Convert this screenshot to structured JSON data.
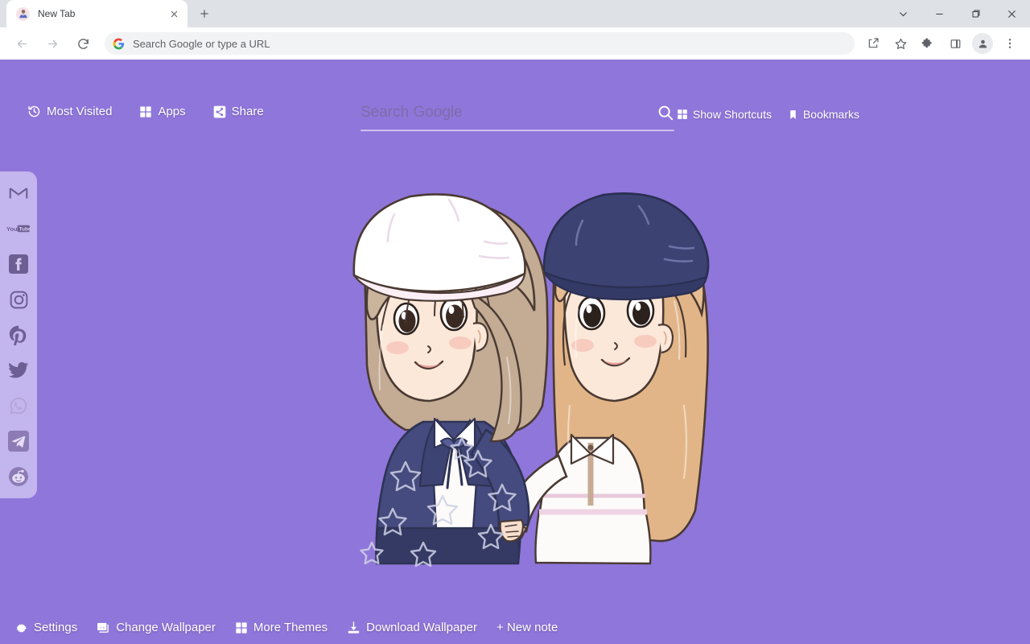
{
  "browser": {
    "tab": {
      "title": "New Tab",
      "favicon_icon": "avatar-person-icon",
      "close_icon": "close-icon"
    },
    "new_tab_button_icon": "plus-icon",
    "window_controls": [
      {
        "name": "tab-search",
        "icon": "chevron-down-icon"
      },
      {
        "name": "minimize",
        "icon": "minimize-icon"
      },
      {
        "name": "maximize",
        "icon": "restore-icon"
      },
      {
        "name": "close",
        "icon": "close-icon"
      }
    ],
    "nav": {
      "back_icon": "arrow-left-icon",
      "forward_icon": "arrow-right-icon",
      "reload_icon": "reload-icon"
    },
    "omnibox": {
      "placeholder": "Search Google or type a URL",
      "value": "",
      "leading_icon": "google-g-icon"
    },
    "toolbar_icons": [
      {
        "name": "share-icon"
      },
      {
        "name": "bookmark-star-icon"
      },
      {
        "name": "extensions-puzzle-icon"
      },
      {
        "name": "side-panel-icon"
      },
      {
        "name": "profile-avatar-icon"
      },
      {
        "name": "more-menu-icon"
      }
    ]
  },
  "newtab": {
    "background_color": "#8f76da",
    "quicknav": [
      {
        "label": "Most Visited",
        "icon": "history-clock-icon"
      },
      {
        "label": "Apps",
        "icon": "grid-apps-icon"
      },
      {
        "label": "Share",
        "icon": "share-icon"
      }
    ],
    "search": {
      "placeholder": "Search Google",
      "value": "",
      "submit_icon": "search-icon"
    },
    "toplinks": [
      {
        "label": "Show Shortcuts",
        "icon": "grid-apps-icon"
      },
      {
        "label": "Bookmarks",
        "icon": "bookmark-icon"
      }
    ],
    "sidebar": {
      "items": [
        {
          "label": "Gmail",
          "icon": "gmail-icon"
        },
        {
          "label": "YouTube",
          "icon": "youtube-icon"
        },
        {
          "label": "Facebook",
          "icon": "facebook-icon"
        },
        {
          "label": "Instagram",
          "icon": "instagram-icon"
        },
        {
          "label": "Pinterest",
          "icon": "pinterest-icon"
        },
        {
          "label": "Twitter",
          "icon": "twitter-icon"
        },
        {
          "label": "WhatsApp",
          "icon": "whatsapp-icon"
        },
        {
          "label": "Telegram",
          "icon": "telegram-icon"
        },
        {
          "label": "Reddit",
          "icon": "reddit-icon"
        }
      ]
    },
    "bottombar": [
      {
        "label": "Settings",
        "icon": "gear-icon"
      },
      {
        "label": "Change Wallpaper",
        "icon": "image-icon"
      },
      {
        "label": "More Themes",
        "icon": "grid-apps-icon"
      },
      {
        "label": "Download Wallpaper",
        "icon": "download-icon"
      },
      {
        "label": "+ New note",
        "icon": "none"
      }
    ],
    "wallpaper": {
      "description": "Illustration of two anime-style girls standing together",
      "left_girl": {
        "hat": "white beret",
        "hair": "light ash brown shoulder-length",
        "outfit": "navy blazer with white star pattern and navy ribbon tie"
      },
      "right_girl": {
        "hat": "navy beret",
        "hair": "long honey blonde",
        "outfit": "white collared jacket with white skirt"
      }
    }
  }
}
